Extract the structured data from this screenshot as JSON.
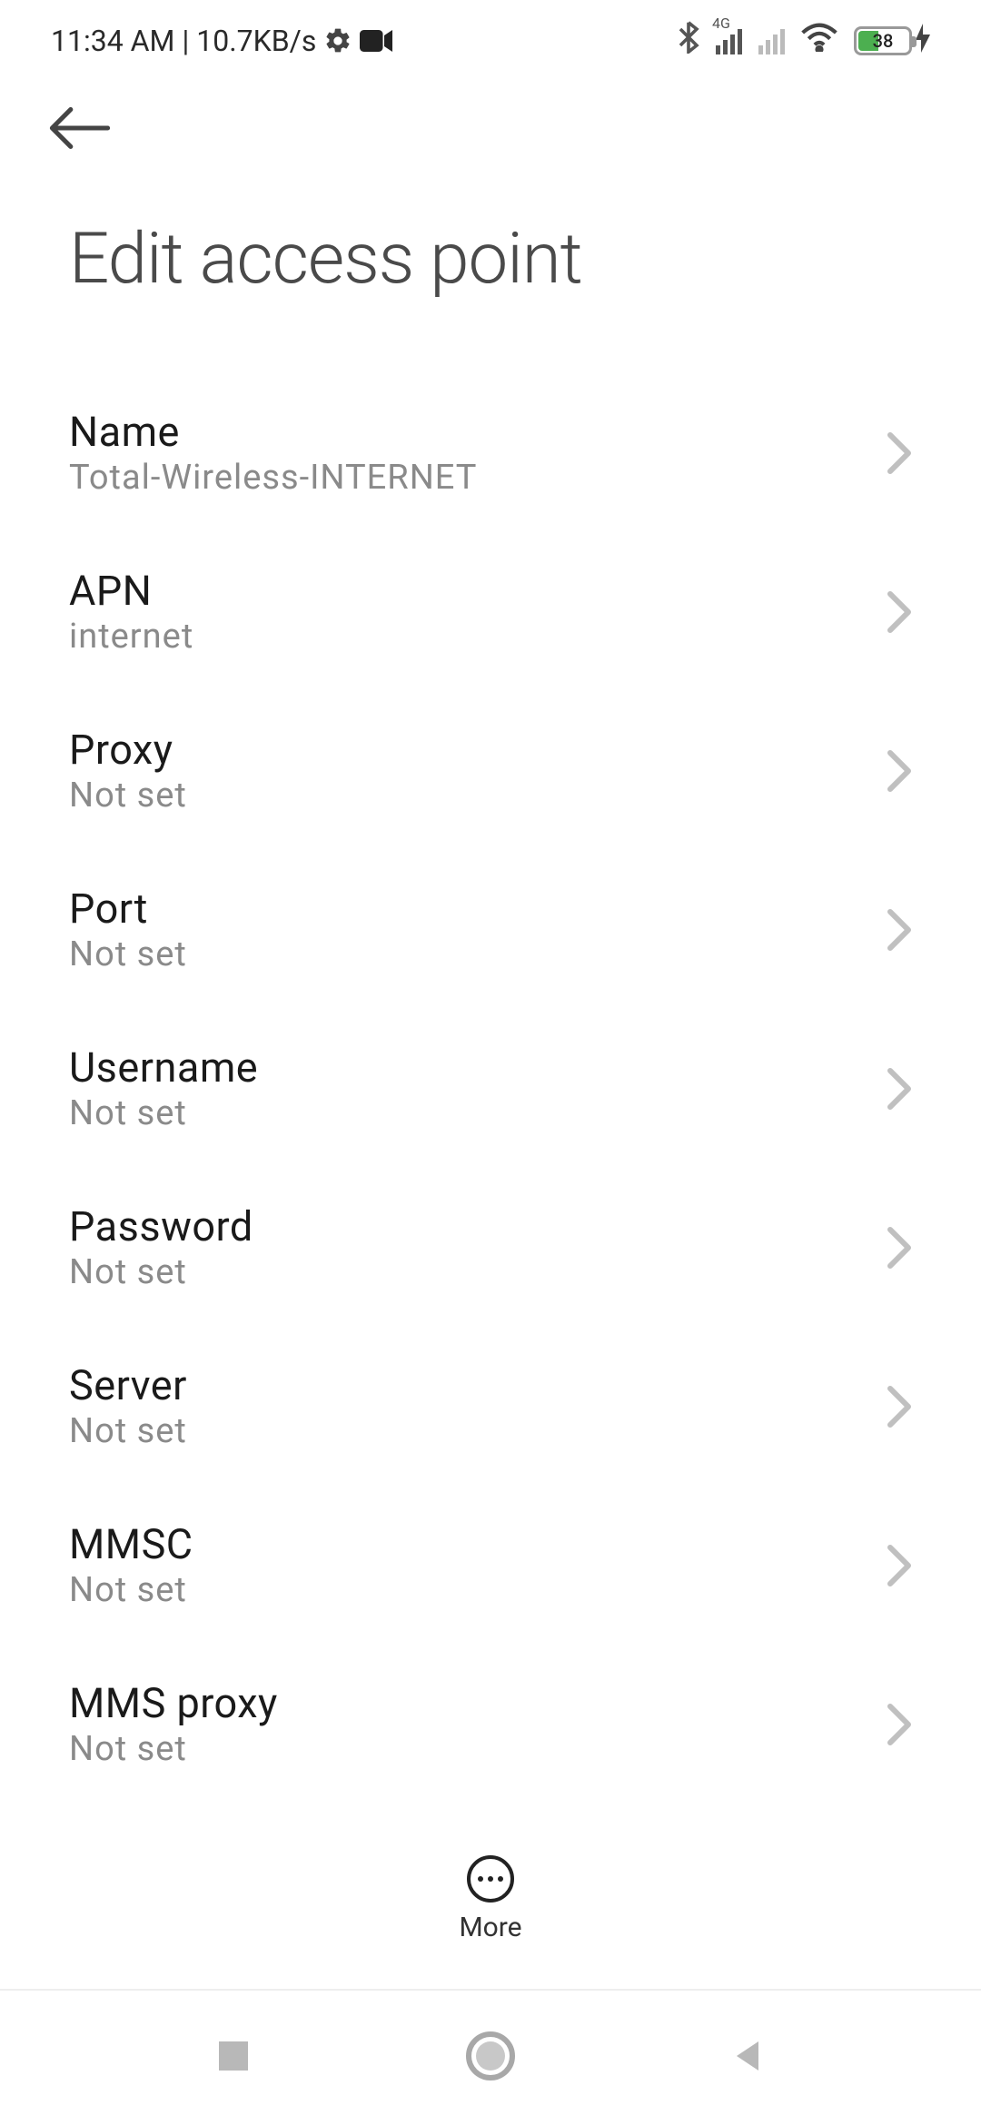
{
  "status": {
    "time": "11:34 AM",
    "net_speed": "10.7KB/s",
    "net_type": "4G",
    "battery_percent": "38"
  },
  "page_title": "Edit access point",
  "more_label": "More",
  "items": [
    {
      "label": "Name",
      "value": "Total-Wireless-INTERNET"
    },
    {
      "label": "APN",
      "value": "internet"
    },
    {
      "label": "Proxy",
      "value": "Not set"
    },
    {
      "label": "Port",
      "value": "Not set"
    },
    {
      "label": "Username",
      "value": "Not set"
    },
    {
      "label": "Password",
      "value": "Not set"
    },
    {
      "label": "Server",
      "value": "Not set"
    },
    {
      "label": "MMSC",
      "value": "Not set"
    },
    {
      "label": "MMS proxy",
      "value": "Not set"
    }
  ]
}
